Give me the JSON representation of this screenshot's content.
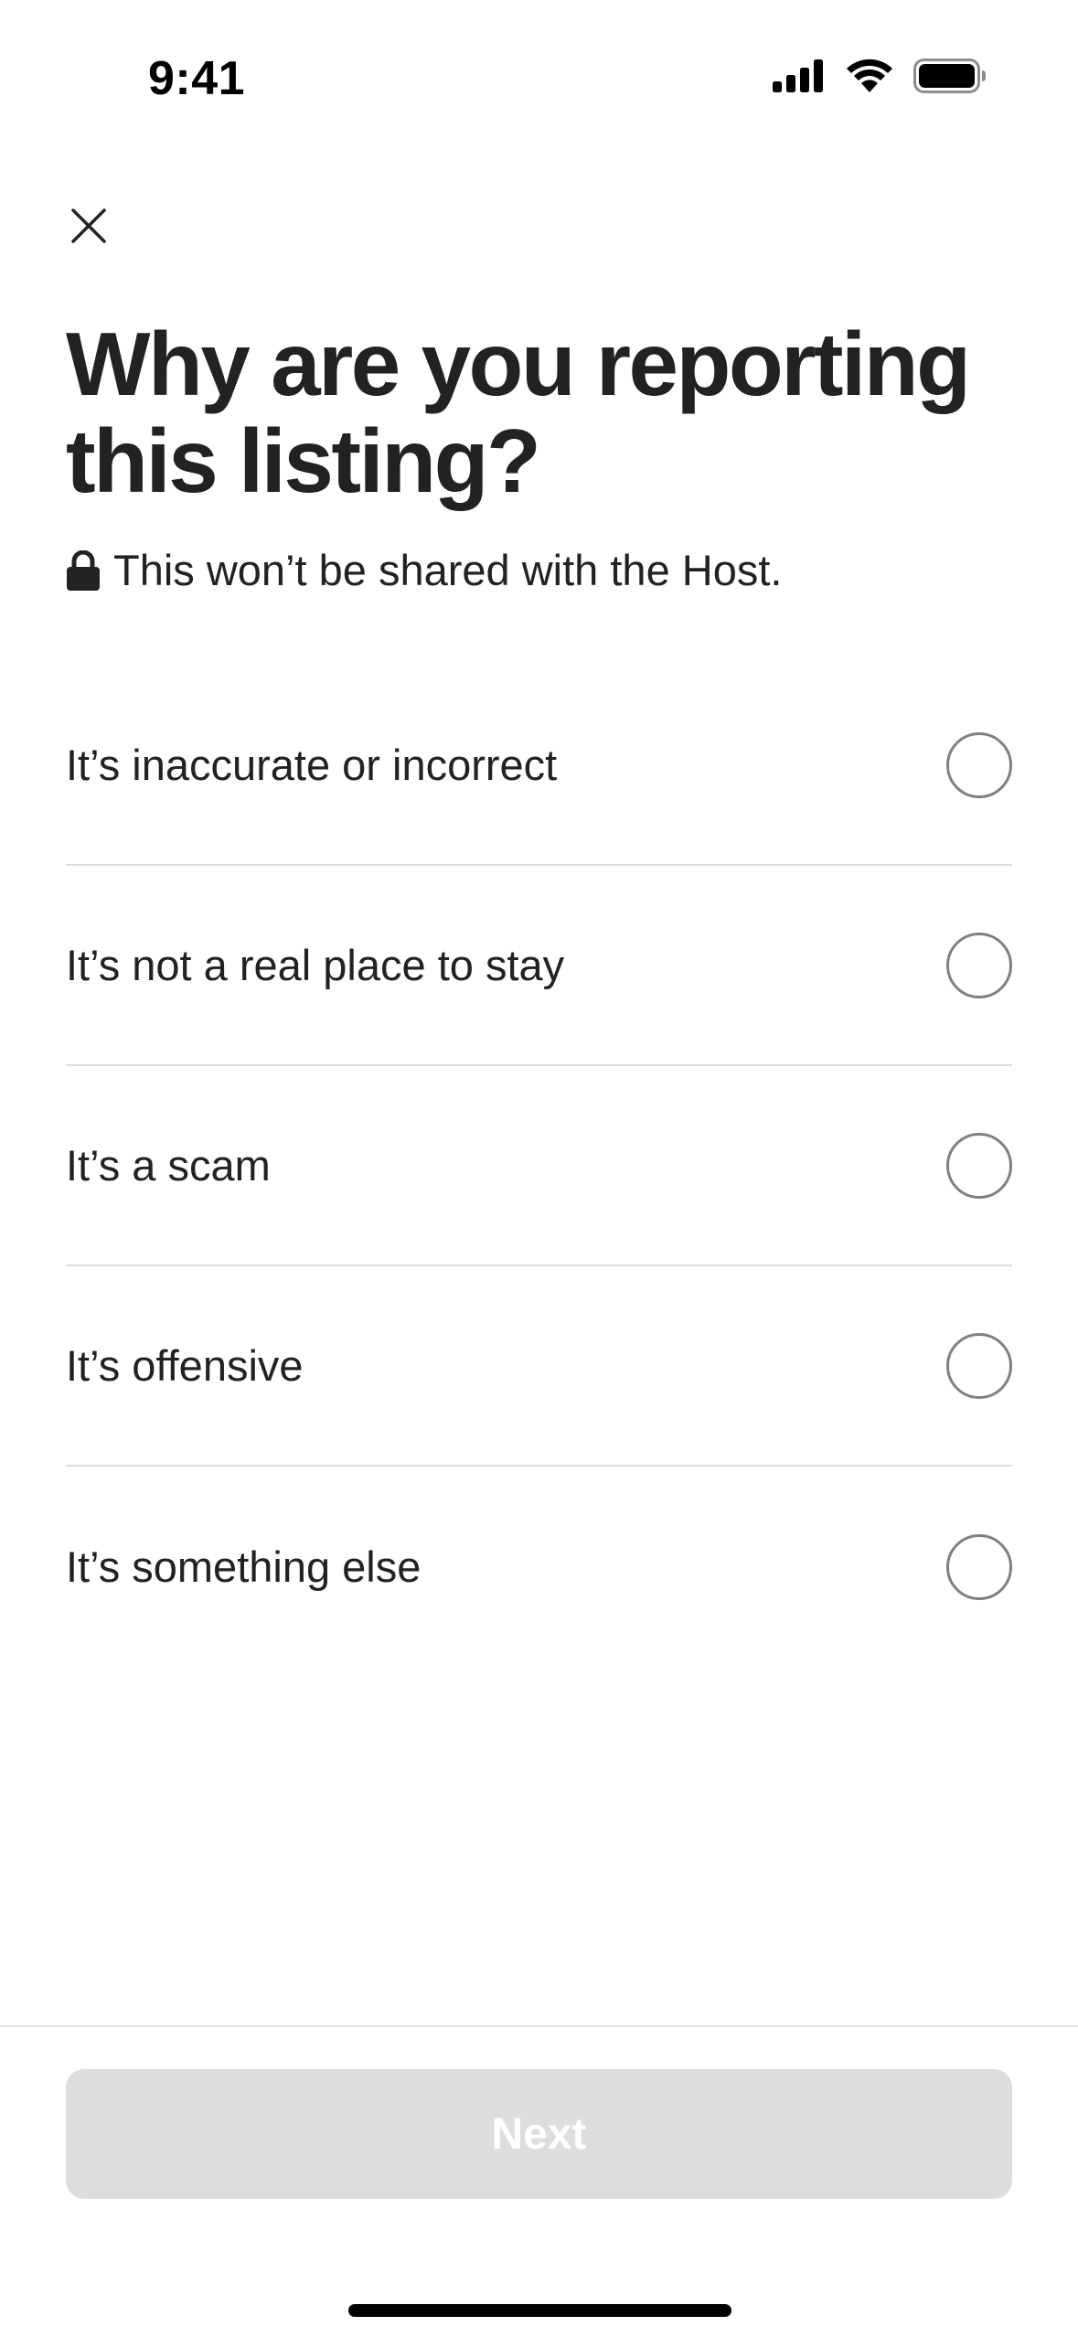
{
  "status_bar": {
    "time": "9:41",
    "icons": [
      "cellular-signal-icon",
      "wifi-icon",
      "battery-icon"
    ]
  },
  "header": {
    "close_icon": "close-icon"
  },
  "main": {
    "title": "Why are you reporting this listing?",
    "privacy_note": "This won’t be shared with the Host.",
    "privacy_icon": "lock-icon",
    "options": [
      {
        "label": "It’s inaccurate or incorrect",
        "selected": false
      },
      {
        "label": "It’s not a real place to stay",
        "selected": false
      },
      {
        "label": "It’s a scam",
        "selected": false
      },
      {
        "label": "It’s offensive",
        "selected": false
      },
      {
        "label": "It’s something else",
        "selected": false
      }
    ]
  },
  "footer": {
    "next_label": "Next",
    "next_enabled": false
  },
  "colors": {
    "text": "#222222",
    "divider": "#dddddd",
    "radio_border": "#808080",
    "button_disabled_bg": "#dddddd",
    "button_disabled_text": "#ffffff"
  }
}
